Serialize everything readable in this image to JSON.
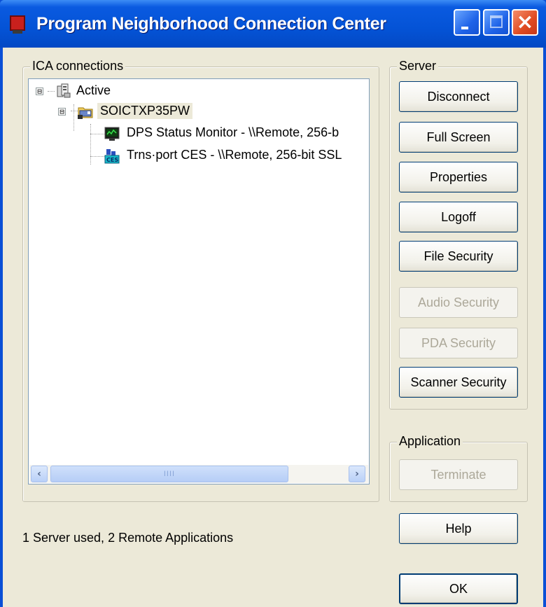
{
  "window": {
    "title": "Program Neighborhood Connection Center"
  },
  "titlebar_buttons": {
    "minimize": "minimize-icon",
    "maximize": "maximize-icon",
    "close": "close-icon"
  },
  "connections_group": {
    "legend": "ICA connections",
    "tree": {
      "root": {
        "label": "Active",
        "expander": "⊟",
        "icon": "servers-icon"
      },
      "server": {
        "label": "SOICTXP35PW",
        "expander": "⊟",
        "icon": "server-folder-icon"
      },
      "apps": [
        {
          "label": "DPS Status Monitor - \\\\Remote, 256-b",
          "icon": "monitor-app-icon"
        },
        {
          "label": "Trns·port CES - \\\\Remote, 256-bit SSL",
          "icon": "ces-app-icon"
        }
      ]
    },
    "scrollbar": {
      "left_arrow": "‹",
      "right_arrow": "›",
      "thumb_grip": "IIII"
    }
  },
  "server_group": {
    "legend": "Server",
    "buttons": [
      {
        "label": "Disconnect",
        "enabled": true
      },
      {
        "label": "Full Screen",
        "enabled": true
      },
      {
        "label": "Properties",
        "enabled": true
      },
      {
        "label": "Logoff",
        "enabled": true
      },
      {
        "label": "File Security",
        "enabled": true
      },
      {
        "label": "Audio Security",
        "enabled": false
      },
      {
        "label": "PDA Security",
        "enabled": false
      },
      {
        "label": "Scanner Security",
        "enabled": true
      }
    ]
  },
  "application_group": {
    "legend": "Application",
    "terminate": {
      "label": "Terminate",
      "enabled": false
    }
  },
  "status_text": "1 Server used, 2 Remote Applications",
  "help_label": "Help",
  "ok_label": "OK",
  "colors": {
    "titlebar": "#0453d6",
    "dialog_bg": "#ece9d8",
    "close_button": "#df4a21",
    "selected_bg": "#ece9d8"
  }
}
